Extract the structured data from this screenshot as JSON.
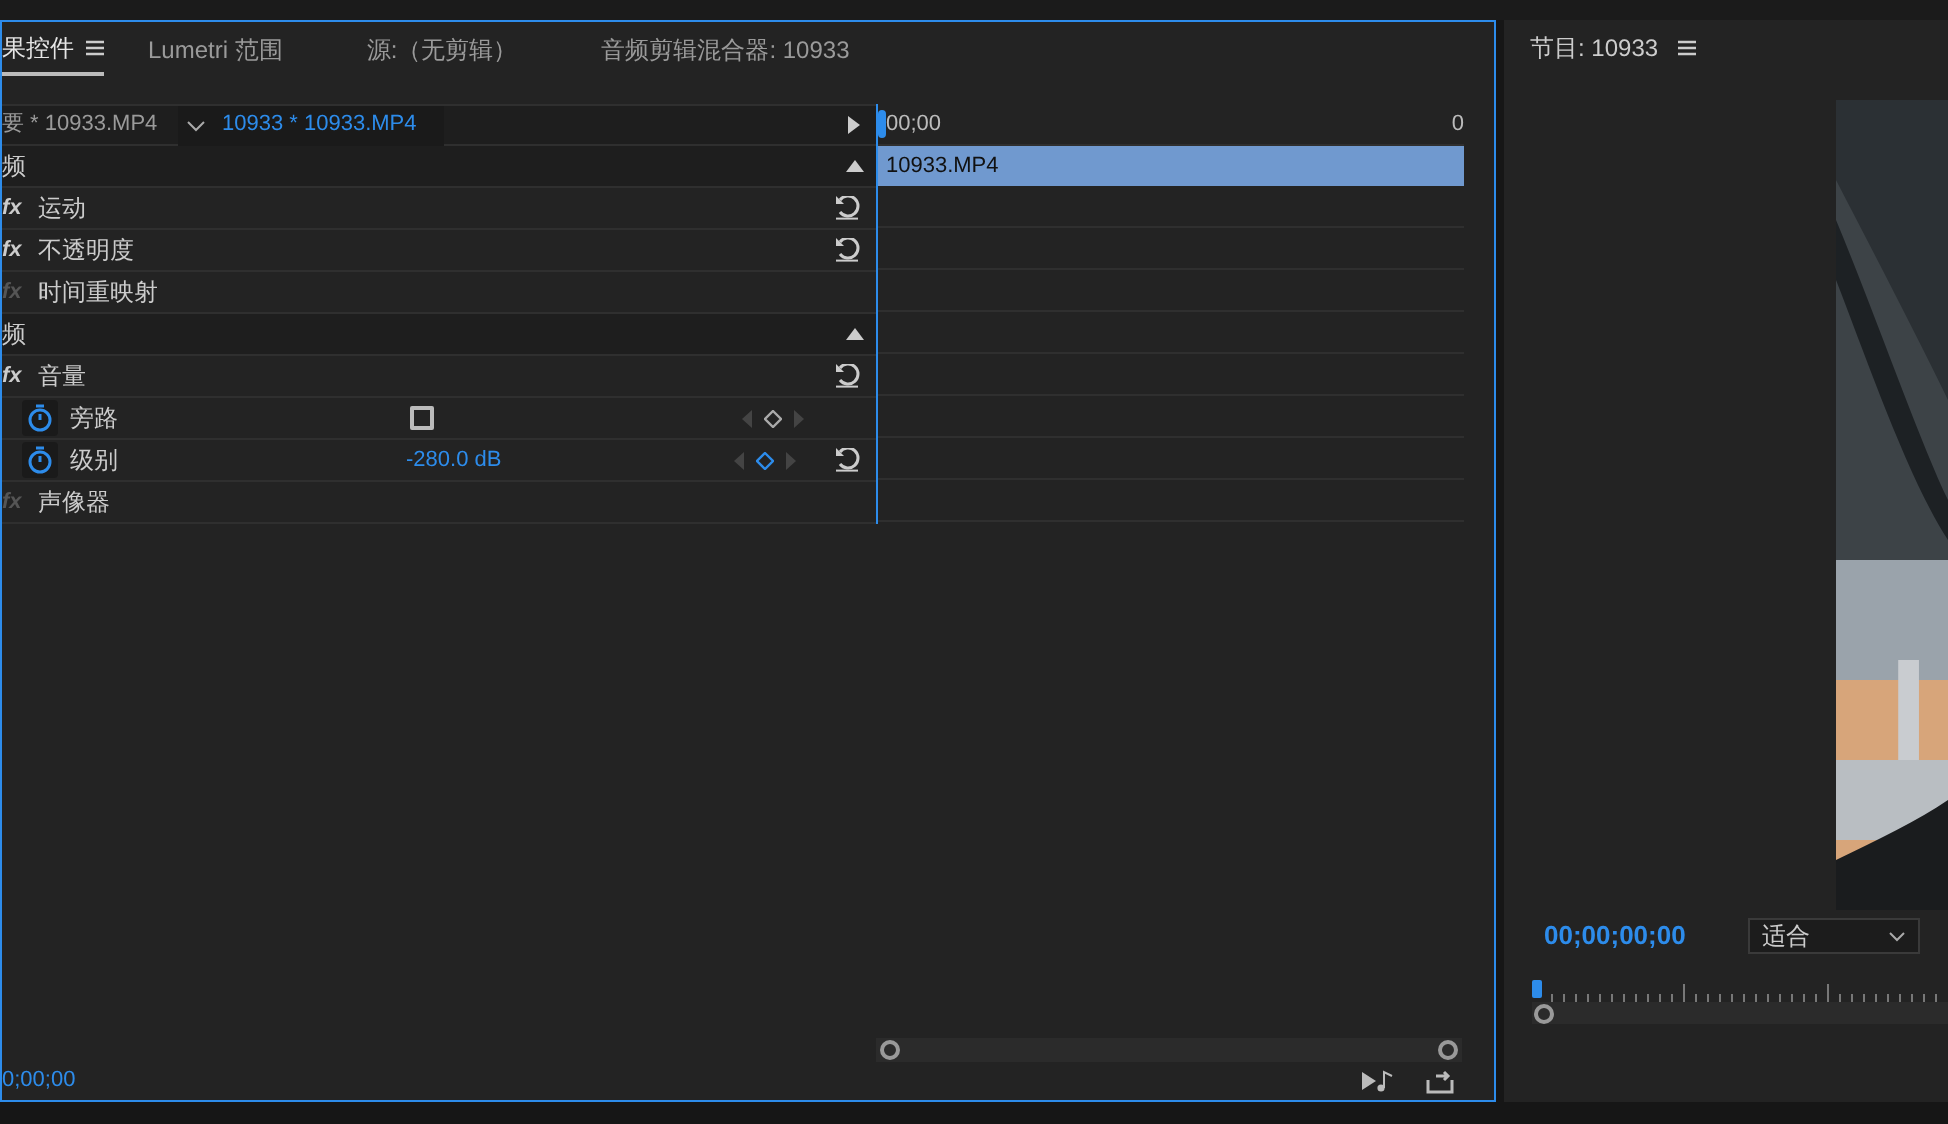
{
  "tabs": [
    {
      "label": "果控件",
      "selected": true
    },
    {
      "label": "Lumetri 范围",
      "selected": false
    },
    {
      "label": "源:（无剪辑）",
      "selected": false
    },
    {
      "label": "音频剪辑混合器: 10933",
      "selected": false
    }
  ],
  "clip_selector": {
    "master": "要 * 10933.MP4",
    "clip": "10933 * 10933.MP4"
  },
  "timeline": {
    "start": "00;00",
    "end": "0",
    "clip": "10933.MP4"
  },
  "rows": [
    {
      "kind": "header",
      "label": "频",
      "expanded": true
    },
    {
      "kind": "effect",
      "fx": "fx",
      "label": "运动",
      "active": true,
      "reset": true
    },
    {
      "kind": "effect",
      "fx": "fx",
      "label": "不透明度",
      "active": true,
      "reset": true
    },
    {
      "kind": "effect",
      "fx": "fx",
      "label": "时间重映射",
      "active": false,
      "reset": false
    },
    {
      "kind": "header",
      "label": "频",
      "expanded": true
    },
    {
      "kind": "effect",
      "fx": "fx",
      "label": "音量",
      "active": true,
      "reset": true
    },
    {
      "kind": "checkbox",
      "label": "旁路",
      "checked": false,
      "keyframed": false,
      "reset": false
    },
    {
      "kind": "value",
      "label": "级别",
      "value": "-280.0 dB",
      "keyframed": true,
      "reset": true
    },
    {
      "kind": "effect",
      "fx": "fx",
      "label": "声像器",
      "active": false,
      "reset": false
    }
  ],
  "footer_timecode": "0;00;00",
  "program": {
    "title": "节目: 10933",
    "timecode": "00;00;00;00",
    "zoom": "适合"
  }
}
